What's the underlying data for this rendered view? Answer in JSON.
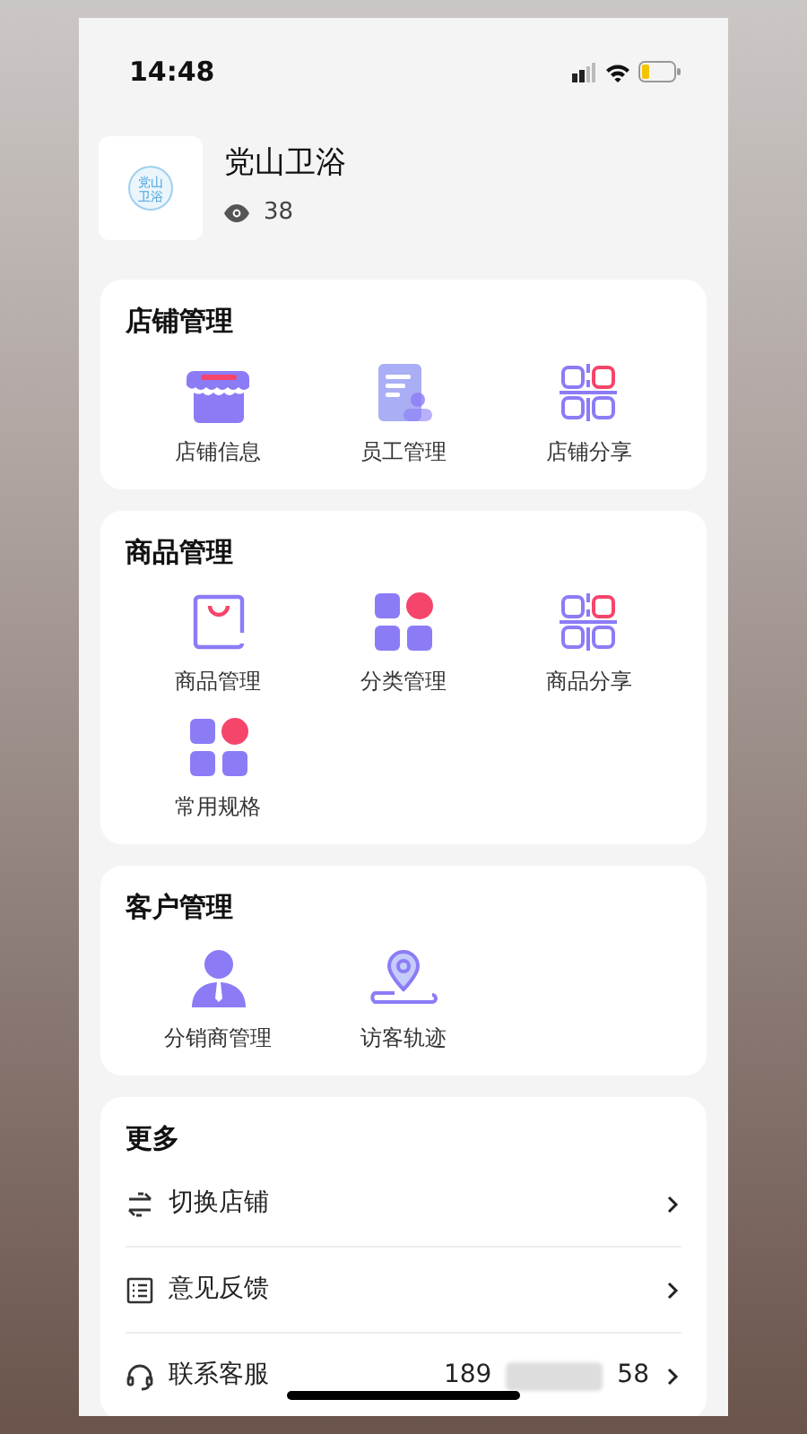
{
  "status_bar": {
    "time": "14:48"
  },
  "shop": {
    "name": "党山卫浴",
    "views": "38",
    "logo_lines": [
      "党山",
      "卫浴"
    ]
  },
  "sections": [
    {
      "title": "店铺管理",
      "items": [
        {
          "label": "店铺信息"
        },
        {
          "label": "员工管理"
        },
        {
          "label": "店铺分享"
        }
      ]
    },
    {
      "title": "商品管理",
      "items": [
        {
          "label": "商品管理"
        },
        {
          "label": "分类管理"
        },
        {
          "label": "商品分享"
        },
        {
          "label": "常用规格"
        }
      ]
    },
    {
      "title": "客户管理",
      "items": [
        {
          "label": "分销商管理"
        },
        {
          "label": "访客轨迹"
        }
      ]
    }
  ],
  "more": {
    "title": "更多",
    "rows": [
      {
        "label": "切换店铺"
      },
      {
        "label": "意见反馈"
      },
      {
        "label": "联系客服",
        "phone_start": "189",
        "phone_end": "58"
      }
    ]
  }
}
